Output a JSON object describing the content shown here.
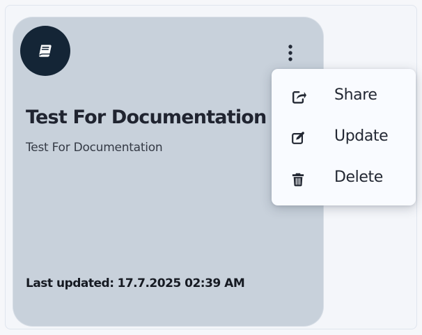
{
  "colors": {
    "page_background": "#f6f7fa",
    "panel_background": "#f4f6fa",
    "card_background": "#c8d1db",
    "badge_background": "#142536",
    "popup_background": "#f9fbff",
    "icon_color": "#232833"
  },
  "card": {
    "title": "Test For Documentation",
    "subtitle": "Test For Documentation",
    "last_updated_label": "Last updated:",
    "last_updated_value": "17.7.2025 02:39 AM",
    "icons": {
      "badge": "notebook-icon",
      "more_options": "kebab-icon"
    }
  },
  "menu": {
    "items": [
      {
        "label": "Share",
        "icon": "share-icon"
      },
      {
        "label": "Update",
        "icon": "edit-icon"
      },
      {
        "label": "Delete",
        "icon": "trash-icon"
      }
    ]
  }
}
